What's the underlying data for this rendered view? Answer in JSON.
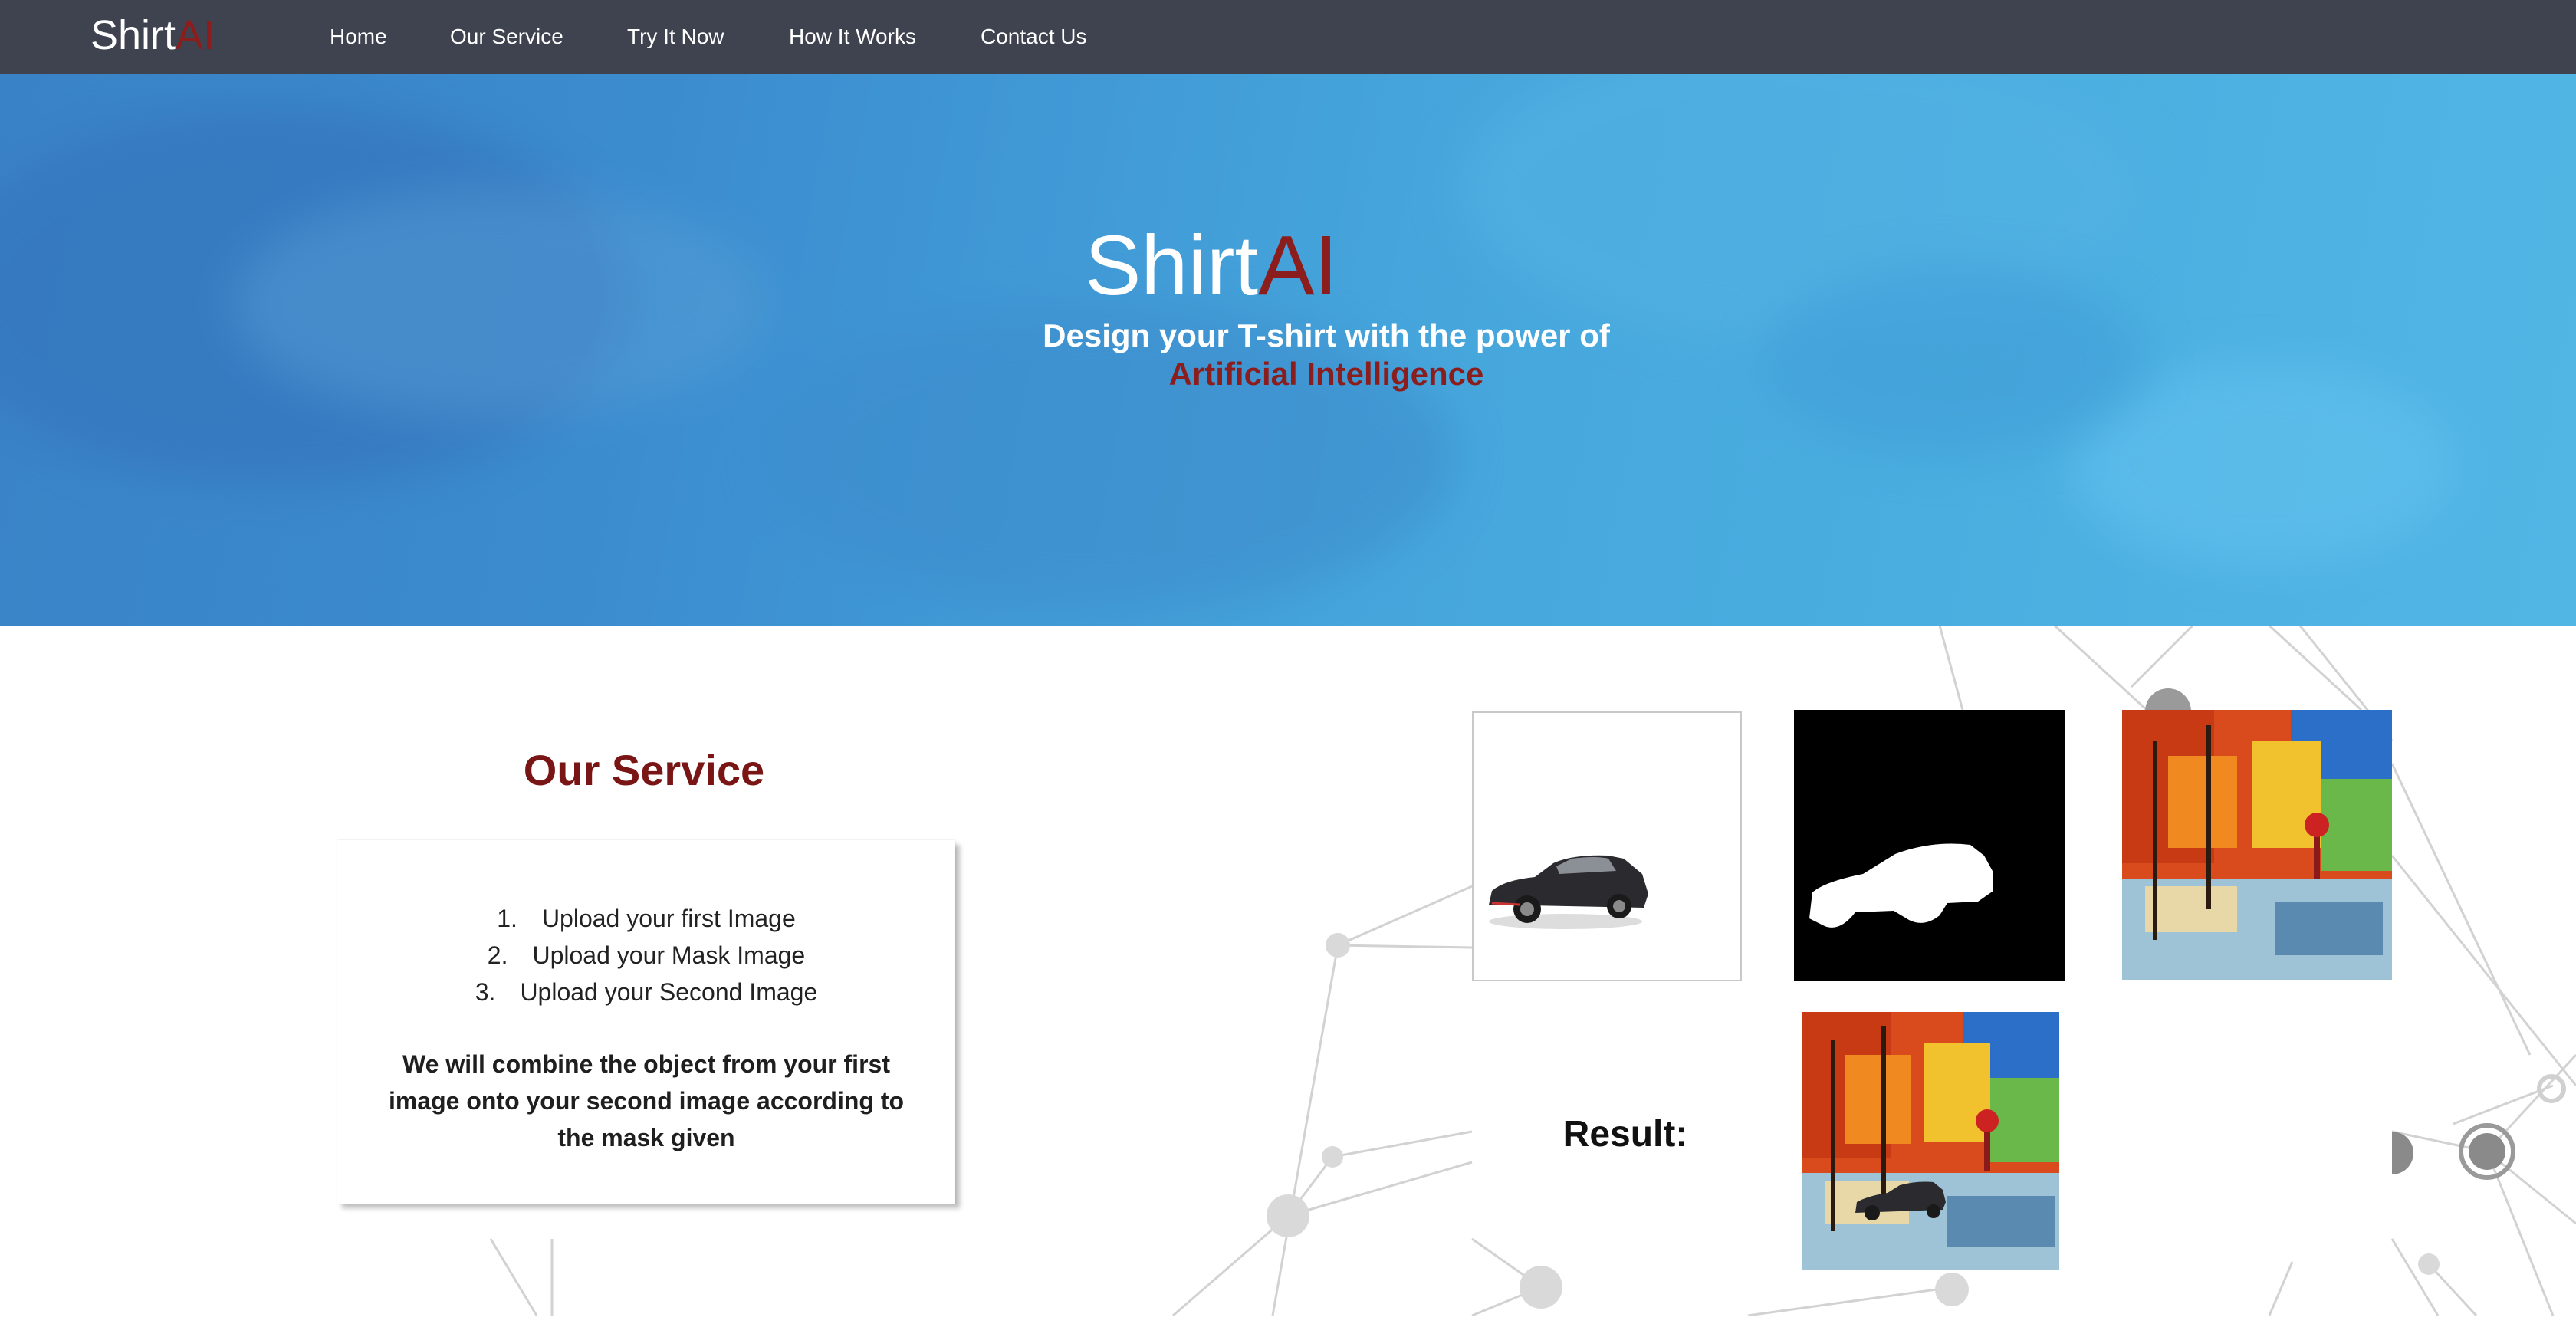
{
  "navbar": {
    "brand_main": "Shirt",
    "brand_accent": "AI",
    "links": [
      "Home",
      "Our Service",
      "Try It Now",
      "How It Works",
      "Contact Us"
    ]
  },
  "hero": {
    "title_main": "Shirt",
    "title_accent": "AI",
    "subtitle": "Design your T-shirt with the power of",
    "subtitle_accent": "Artificial Intelligence"
  },
  "service": {
    "title": "Our Service",
    "steps": [
      {
        "num": "1.",
        "text": "Upload your first Image"
      },
      {
        "num": "2.",
        "text": "Upload your Mask Image"
      },
      {
        "num": "3.",
        "text": "Upload your Second Image"
      }
    ],
    "description": "We will combine the object from your first image onto your second image according to the mask given"
  },
  "examples": {
    "result_label": "Result:"
  },
  "colors": {
    "navbar_bg": "#3e434f",
    "accent_red": "#8c1d1d",
    "hero_blue": "#3b8ccf"
  }
}
